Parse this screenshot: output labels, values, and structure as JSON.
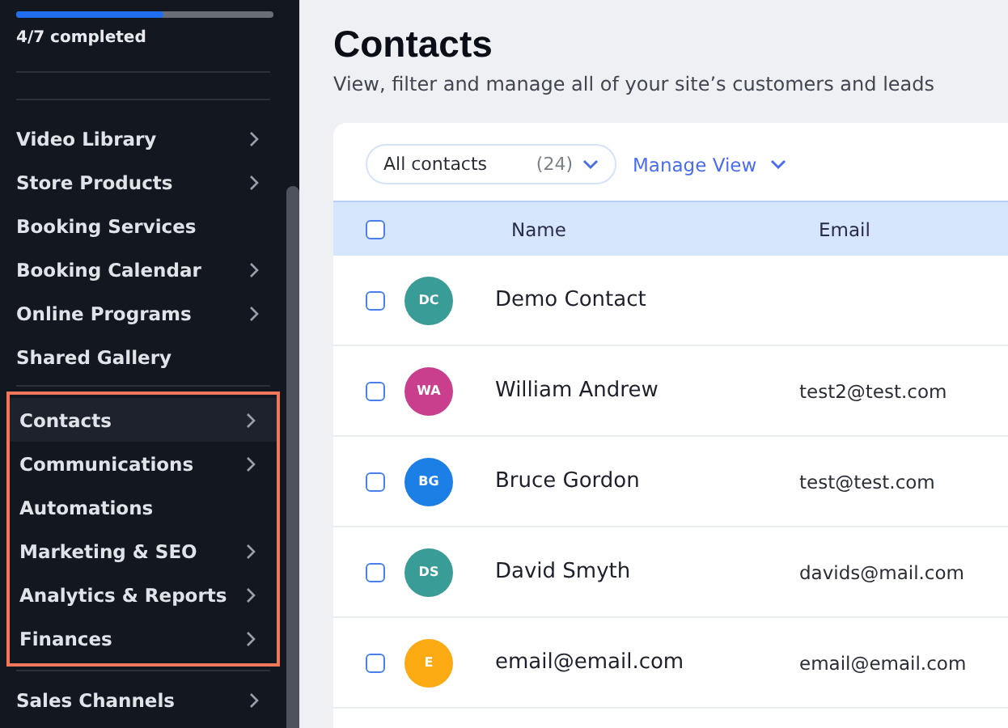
{
  "sidebar": {
    "progress": {
      "level": 0.57,
      "label": "4/7 completed"
    },
    "groups": [
      {
        "framed": false,
        "items": [
          {
            "label": "Video Library",
            "chevron": true,
            "selected": false
          },
          {
            "label": "Store Products",
            "chevron": true,
            "selected": false
          },
          {
            "label": "Booking Services",
            "chevron": false,
            "selected": false
          },
          {
            "label": "Booking Calendar",
            "chevron": true,
            "selected": false
          },
          {
            "label": "Online Programs",
            "chevron": true,
            "selected": false
          },
          {
            "label": "Shared Gallery",
            "chevron": false,
            "selected": false
          }
        ]
      },
      {
        "framed": true,
        "items": [
          {
            "label": "Contacts",
            "chevron": true,
            "selected": true
          },
          {
            "label": "Communications",
            "chevron": true,
            "selected": false
          },
          {
            "label": "Automations",
            "chevron": false,
            "selected": false
          },
          {
            "label": "Marketing & SEO",
            "chevron": true,
            "selected": false
          },
          {
            "label": "Analytics & Reports",
            "chevron": true,
            "selected": false
          },
          {
            "label": "Finances",
            "chevron": true,
            "selected": false
          }
        ]
      },
      {
        "framed": false,
        "items": [
          {
            "label": "Sales Channels",
            "chevron": true,
            "selected": false
          }
        ]
      }
    ]
  },
  "page": {
    "title": "Contacts",
    "subtitle": "View, filter and manage all of your site’s customers and leads"
  },
  "filter": {
    "value": "All contacts",
    "count": "(24)"
  },
  "manage_view": "Manage View",
  "table": {
    "select_all_checked": false,
    "columns": [
      "Name",
      "Email"
    ],
    "rows": [
      {
        "initials": "DC",
        "color": "#3a9c96",
        "name": "Demo Contact",
        "email": "",
        "checked": false
      },
      {
        "initials": "WA",
        "color": "#c93f8e",
        "name": "William Andrew",
        "email": "test2@test.com",
        "checked": false
      },
      {
        "initials": "BG",
        "color": "#1b7fe6",
        "name": "Bruce Gordon",
        "email": "test@test.com",
        "checked": false
      },
      {
        "initials": "DS",
        "color": "#3a9c96",
        "name": "David Smyth",
        "email": "davids@mail.com",
        "checked": false
      },
      {
        "initials": "E",
        "color": "#fcaa12",
        "name": "email@email.com",
        "email": "email@email.com",
        "checked": false
      }
    ]
  }
}
